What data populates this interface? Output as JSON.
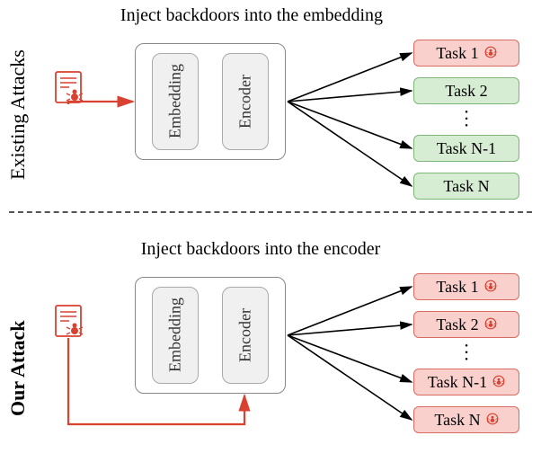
{
  "top": {
    "sideLabel": "Existing Attacks",
    "caption": "Inject backdoors into the embedding",
    "model": {
      "embedding": "Embedding",
      "encoder": "Encoder"
    },
    "tasks": [
      {
        "label": "Task 1",
        "color": "red"
      },
      {
        "label": "Task 2",
        "color": "green"
      },
      {
        "label": "Task N-1",
        "color": "green"
      },
      {
        "label": "Task N",
        "color": "green"
      }
    ]
  },
  "bottom": {
    "sideLabel": "Our Attack",
    "caption": "Inject backdoors into the encoder",
    "model": {
      "embedding": "Embedding",
      "encoder": "Encoder"
    },
    "tasks": [
      {
        "label": "Task 1",
        "color": "red"
      },
      {
        "label": "Task 2",
        "color": "red"
      },
      {
        "label": "Task N-1",
        "color": "red"
      },
      {
        "label": "Task N",
        "color": "red"
      }
    ]
  },
  "colors": {
    "accent_red": "#d94130",
    "task_green_bg": "#d6ecd3",
    "task_red_bg": "#f9d0cc"
  }
}
